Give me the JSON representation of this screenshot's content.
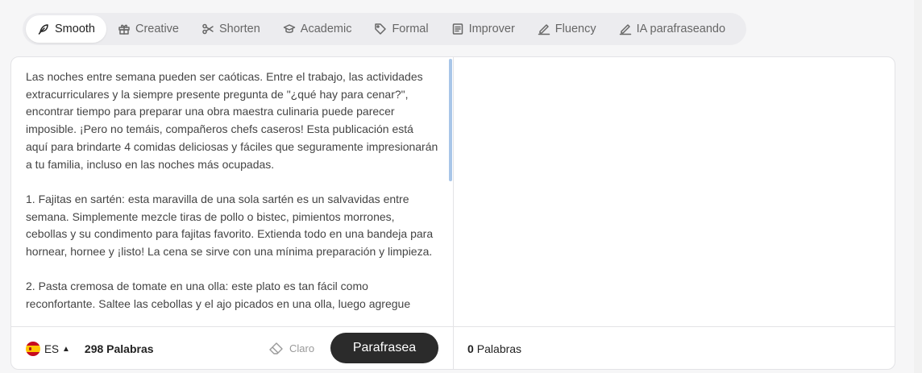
{
  "modes": [
    {
      "label": "Smooth",
      "icon": "feather-icon",
      "active": true
    },
    {
      "label": "Creative",
      "icon": "gift-icon",
      "active": false
    },
    {
      "label": "Shorten",
      "icon": "scissors-icon",
      "active": false
    },
    {
      "label": "Academic",
      "icon": "graduation-cap-icon",
      "active": false
    },
    {
      "label": "Formal",
      "icon": "tag-icon",
      "active": false
    },
    {
      "label": "Improver",
      "icon": "document-icon",
      "active": false
    },
    {
      "label": "Fluency",
      "icon": "pen-line-icon",
      "active": false
    },
    {
      "label": "IA parafraseando",
      "icon": "pen-line-icon",
      "active": false
    }
  ],
  "editor": {
    "source_text": "Las noches entre semana pueden ser caóticas. Entre el trabajo, las actividades extracurriculares y la siempre presente pregunta de \"¿qué hay para cenar?\", encontrar tiempo para preparar una obra maestra culinaria puede parecer imposible. ¡Pero no temáis, compañeros chefs caseros! Esta publicación está aquí para brindarte 4 comidas deliciosas y fáciles que seguramente impresionarán a tu familia, incluso en las noches más ocupadas.\n\n1. Fajitas en sartén: esta maravilla de una sola sartén es un salvavidas entre semana. Simplemente mezcle tiras de pollo o bistec, pimientos morrones, cebollas y su condimento para fajitas favorito. Extienda todo en una bandeja para hornear, hornee y ¡listo! La cena se sirve con una mínima preparación y limpieza.\n\n2. Pasta cremosa de tomate en una olla: este plato es tan fácil como reconfortante. Saltee las cebollas y el ajo picados en una olla, luego agregue",
    "output_text": ""
  },
  "footer": {
    "language": "ES",
    "input_word_count": "298",
    "words_label": "Palabras",
    "clear_label": "Claro",
    "paraphrase_button": "Parafrasea",
    "output_word_count": "0",
    "output_words_label": "Palabras"
  },
  "colors": {
    "accent": "#2b2b2b",
    "scroll_thumb": "#a9c6e8"
  }
}
